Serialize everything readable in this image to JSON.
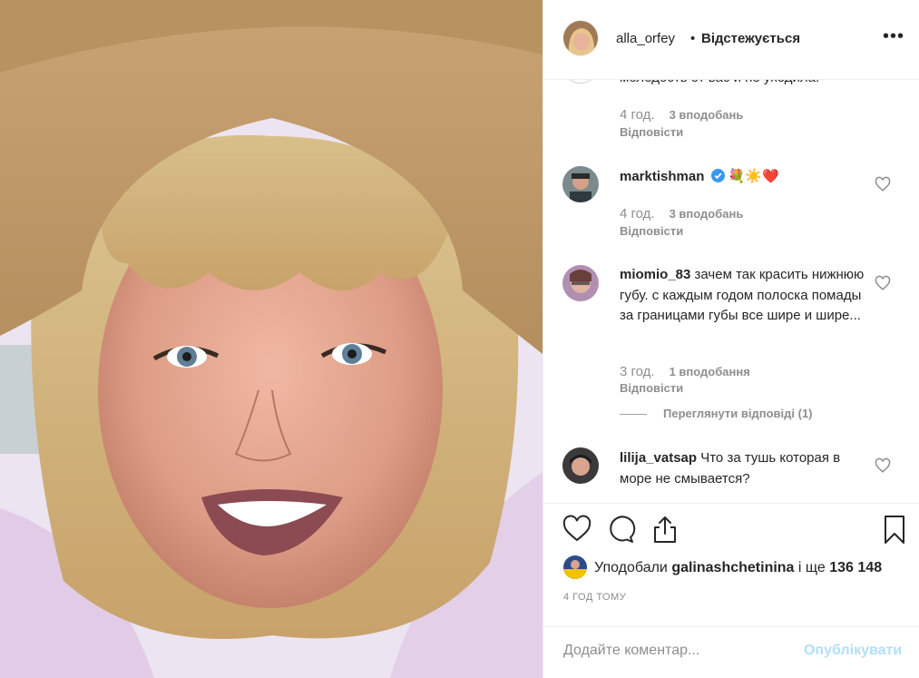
{
  "header": {
    "username": "alla_orfey",
    "separator": "•",
    "follow_status": "Відстежується",
    "more": "•••"
  },
  "comments": {
    "cut_text": "молодость от вас и не уходила.",
    "cut_meta": {
      "time": "4 год.",
      "likes": "3 вподобань",
      "reply": "Відповісти"
    },
    "items": [
      {
        "username": "marktishman",
        "text": "💐☀️❤️",
        "verified": true,
        "time": "4 год.",
        "likes": "3 вподобань",
        "reply": "Відповісти"
      },
      {
        "username": "miomio_83",
        "text": "зачем так красить нижнюю губу. с каждым годом полоска помады за границами губы все шире и шире...",
        "time": "3 год.",
        "likes": "1 вподобання",
        "reply": "Відповісти",
        "view_replies": "Переглянути відповіді (1)"
      },
      {
        "username": "lilija_vatsap",
        "text": "Что за тушь которая в море не смывается?"
      }
    ]
  },
  "likes": {
    "prefix": "Уподобали",
    "user": "galinashchetinina",
    "suffix": "і ще",
    "count": "136 148"
  },
  "time_ago": "4 ГОД ТОМУ",
  "add_comment": {
    "placeholder": "Додайте коментар...",
    "post_label": "Опублікувати"
  },
  "icons": {
    "like": "heart-icon",
    "comment": "comment-icon",
    "share": "share-icon",
    "save": "bookmark-icon",
    "more": "more-icon",
    "verified": "verified-badge-icon"
  },
  "colors": {
    "text": "#262626",
    "secondary": "#8e8e8e",
    "verified": "#3897f0",
    "post_disabled": "#b2dffc",
    "border": "#efefef"
  }
}
